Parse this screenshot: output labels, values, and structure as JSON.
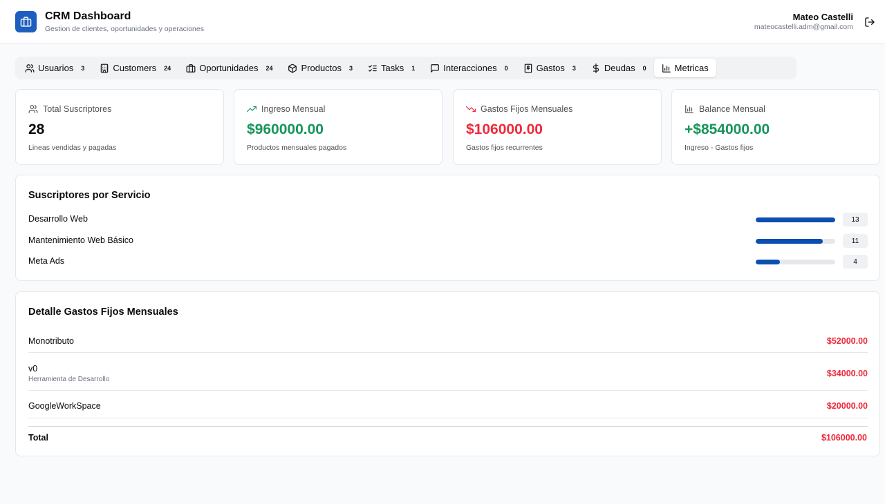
{
  "header": {
    "title": "CRM Dashboard",
    "subtitle": "Gestion de clientes, oportunidades y operaciones",
    "user_name": "Mateo Castelli",
    "user_email": "mateocastelli.adm@gmail.com",
    "logo_icon": "briefcase-icon",
    "logout_icon": "logout-icon",
    "brand_color": "#1d5fbe"
  },
  "tabs": [
    {
      "label": "Usuarios",
      "count": "3",
      "icon": "users-icon"
    },
    {
      "label": "Customers",
      "count": "24",
      "icon": "building-icon"
    },
    {
      "label": "Oportunidades",
      "count": "24",
      "icon": "briefcase-icon"
    },
    {
      "label": "Productos",
      "count": "3",
      "icon": "package-icon"
    },
    {
      "label": "Tasks",
      "count": "1",
      "icon": "list-checks-icon"
    },
    {
      "label": "Interacciones",
      "count": "0",
      "icon": "message-square-icon"
    },
    {
      "label": "Gastos",
      "count": "3",
      "icon": "receipt-icon"
    },
    {
      "label": "Deudas",
      "count": "0",
      "icon": "dollar-icon"
    },
    {
      "label": "Metricas",
      "count": "",
      "icon": "bar-chart-icon",
      "active": true
    }
  ],
  "stats": [
    {
      "label": "Total Suscriptores",
      "value": "28",
      "desc": "Lineas vendidas y pagadas",
      "icon": "users-icon",
      "color": "#0a0a0a"
    },
    {
      "label": "Ingreso Mensual",
      "value": "$960000.00",
      "desc": "Productos mensuales pagados",
      "icon": "trending-up-icon",
      "color": "#16955b"
    },
    {
      "label": "Gastos Fijos Mensuales",
      "value": "$106000.00",
      "desc": "Gastos fijos recurrentes",
      "icon": "trending-down-icon",
      "color": "#ee2a3b"
    },
    {
      "label": "Balance Mensual",
      "value": "+$854000.00",
      "desc": "Ingreso - Gastos fijos",
      "icon": "bar-chart-icon",
      "color": "#16955b"
    }
  ],
  "subscribers": {
    "title": "Suscriptores por Servicio",
    "items": [
      {
        "name": "Desarrollo Web",
        "count": "13",
        "fraction": 1.0
      },
      {
        "name": "Mantenimiento Web Básico",
        "count": "11",
        "fraction": 0.846
      },
      {
        "name": "Meta Ads",
        "count": "4",
        "fraction": 0.308
      }
    ]
  },
  "expenses": {
    "title": "Detalle Gastos Fijos Mensuales",
    "items": [
      {
        "name": "Monotributo",
        "note": "",
        "amount": "$52000.00"
      },
      {
        "name": "v0",
        "note": "Herramienta de Desarrollo",
        "amount": "$34000.00"
      },
      {
        "name": "GoogleWorkSpace",
        "note": "",
        "amount": "$20000.00"
      }
    ],
    "total_label": "Total",
    "total_amount": "$106000.00"
  }
}
